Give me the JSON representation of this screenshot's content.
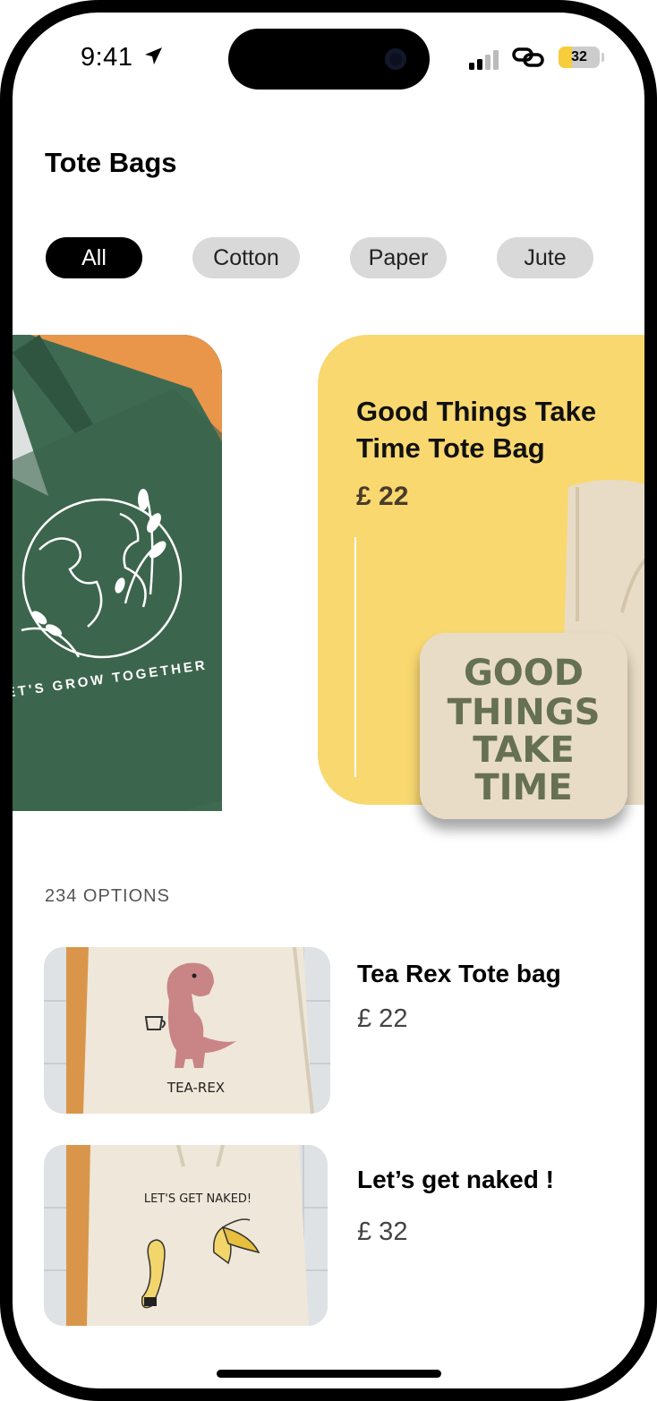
{
  "status_bar": {
    "time": "9:41",
    "battery": "32",
    "battery_level": 0.32
  },
  "header": {
    "title": "Tote Bags"
  },
  "filters": {
    "chips": [
      "All",
      "Cotton",
      "Paper",
      "Jute"
    ],
    "active_index": 0
  },
  "featured": {
    "left_card": {
      "print_text": "LET'S GROW TOGETHER"
    },
    "card": {
      "name": "Good Things Take Time Tote Bag",
      "price": "£ 22",
      "print_lines": [
        "GOOD",
        "THINGS",
        "TAKE",
        "TIME"
      ]
    }
  },
  "options_count": "234 OPTIONS",
  "products": [
    {
      "name": "Tea Rex Tote bag",
      "price": "£ 22",
      "print_text": "TEA-REX"
    },
    {
      "name": "Let’s get naked !",
      "price": "£ 32",
      "print_text": "LET'S GET NAKED!"
    }
  ],
  "colors": {
    "accent_yellow": "#f9d870",
    "green_bag": "#3f6a52",
    "orange": "#e9954a",
    "chip_bg": "#d9d9d9"
  }
}
